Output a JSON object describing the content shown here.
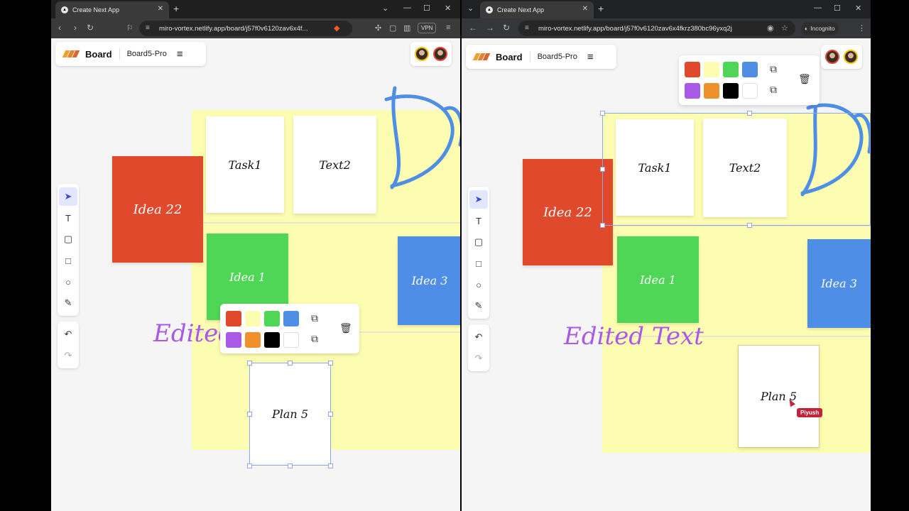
{
  "left_window": {
    "tab_title": "Create Next App",
    "url": "miro-vortex.netlify.app/board/j57f0v6120zav6x4f...",
    "vpn_label": "VPN",
    "board_title": "Board",
    "board_name": "Board5-Pro",
    "notes": {
      "task1": "Task1",
      "text2": "Text2",
      "idea22": "Idea 22",
      "idea1": "Idea 1",
      "idea3": "Idea 3",
      "plan5": "Plan 5"
    },
    "edited_text": "Edited"
  },
  "right_window": {
    "tab_title": "Create Next App",
    "url": "miro-vortex.netlify.app/board/j57f0v6120zav6x4fkrz380bc96yxq2j",
    "incognito_label": "Incognito",
    "board_title": "Board",
    "board_name": "Board5-Pro",
    "notes": {
      "task1": "Task1",
      "text2": "Text2",
      "idea22": "Idea 22",
      "idea1": "Idea 1",
      "idea3": "Idea 3",
      "plan5": "Plan 5"
    },
    "edited_text": "Edited Text",
    "cursor_user": "Piyush"
  },
  "palette_colors": [
    "#e0492c",
    "#fdfdb1",
    "#50d656",
    "#4f8ee6",
    "#a859e6",
    "#f0902c",
    "#000000",
    "#ffffff"
  ],
  "tools": [
    "select-icon",
    "text-icon",
    "note-icon",
    "rectangle-icon",
    "ellipse-icon",
    "pencil-icon",
    "undo-icon",
    "redo-icon"
  ]
}
